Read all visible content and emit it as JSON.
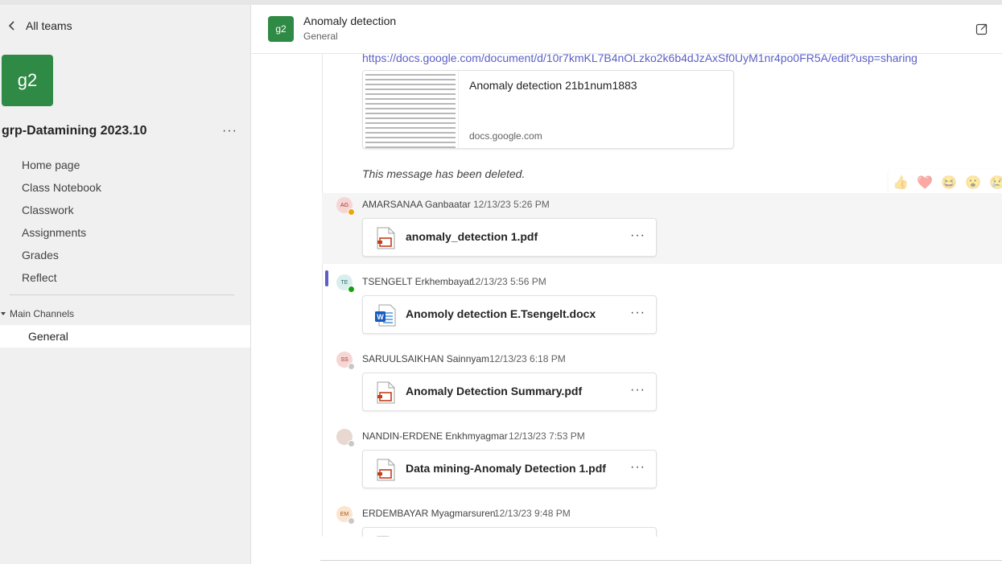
{
  "sidebar": {
    "back_label": "All teams",
    "team_initials": "g2",
    "team_name": "grp-Datamining 2023.10",
    "more": "···",
    "nav": [
      {
        "label": "Home page"
      },
      {
        "label": "Class Notebook"
      },
      {
        "label": "Classwork"
      },
      {
        "label": "Assignments"
      },
      {
        "label": "Grades"
      },
      {
        "label": "Reflect"
      }
    ],
    "channels_header": "Main Channels",
    "channel_selected": "General"
  },
  "header": {
    "initials": "g2",
    "title": "Anomaly detection",
    "subtitle": "General"
  },
  "feed": {
    "link_url": "https://docs.google.com/document/d/10r7kmKL7B4nOLzko2k6b4dJzAxSf0UyM1nr4po0FR5A/edit?usp=sharing",
    "preview": {
      "title": "Anomaly detection 21b1num1883",
      "domain": "docs.google.com"
    },
    "deleted_text": "This message has been deleted.",
    "reactions": [
      "👍",
      "❤️",
      "😆",
      "😮",
      "😢"
    ],
    "messages": [
      {
        "initials": "AG",
        "author": "AMARSANAA Ganbaatar",
        "time": "12/13/23 5:26 PM",
        "file": "anomaly_detection 1.pdf",
        "file_type": "pdf",
        "avatar_bg": "#f6d6d3",
        "avatar_fg": "#a4373a",
        "status": "#f0a30a"
      },
      {
        "initials": "TE",
        "author": "TSENGELT Erkhembayar",
        "time": "12/13/23 5:56 PM",
        "file": "Anomoly detection E.Tsengelt.docx",
        "file_type": "docx",
        "avatar_bg": "#d9efee",
        "avatar_fg": "#2e6b69",
        "status": "#13a10e"
      },
      {
        "initials": "SS",
        "author": "SARUULSAIKHAN Sainnyam",
        "time": "12/13/23 6:18 PM",
        "file": "Anomaly Detection Summary.pdf",
        "file_type": "pdf",
        "avatar_bg": "#f6d6d3",
        "avatar_fg": "#a4373a",
        "status": "#c8c8c8"
      },
      {
        "initials": "",
        "author": "NANDIN-ERDENE Enkhmyagmar",
        "time": "12/13/23 7:53 PM",
        "file": "Data mining-Anomaly Detection 1.pdf",
        "file_type": "pdf",
        "avatar_bg": "#e8d8cf",
        "avatar_fg": "#4a3a33",
        "status": "#c8c8c8"
      },
      {
        "initials": "EM",
        "author": "ERDEMBAYAR Myagmarsuren",
        "time": "12/13/23 9:48 PM",
        "file": "",
        "file_type": "pdf",
        "avatar_bg": "#fbe5cf",
        "avatar_fg": "#a35a1a",
        "status": "#c8c8c8"
      }
    ],
    "file_more": "···"
  }
}
